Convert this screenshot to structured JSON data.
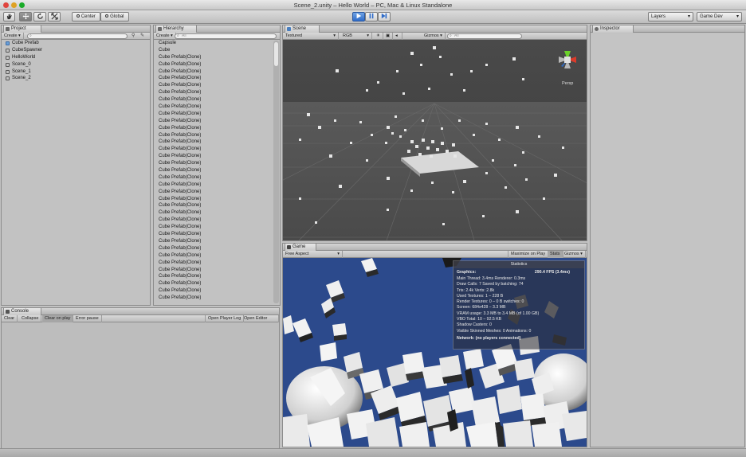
{
  "window": {
    "title": "Scene_2.unity – Hello World – PC, Mac & Linux Standalone"
  },
  "toolbar": {
    "pivot_label": "Center",
    "space_label": "Global",
    "layers_label": "Layers",
    "layout_label": "Game Dev"
  },
  "project": {
    "tab": "Project",
    "create_label": "Create",
    "items": [
      "Cube Prefab",
      "CubeSpawner",
      "HelloWorld",
      "Scene_0",
      "Scene_1",
      "Scene_2"
    ]
  },
  "hierarchy": {
    "tab": "Hierarchy",
    "create_label": "Create",
    "search_placeholder": "All",
    "items": [
      "Capsule",
      "Cube",
      "Cube Prefab(Clone)",
      "Cube Prefab(Clone)",
      "Cube Prefab(Clone)",
      "Cube Prefab(Clone)",
      "Cube Prefab(Clone)",
      "Cube Prefab(Clone)",
      "Cube Prefab(Clone)",
      "Cube Prefab(Clone)",
      "Cube Prefab(Clone)",
      "Cube Prefab(Clone)",
      "Cube Prefab(Clone)",
      "Cube Prefab(Clone)",
      "Cube Prefab(Clone)",
      "Cube Prefab(Clone)",
      "Cube Prefab(Clone)",
      "Cube Prefab(Clone)",
      "Cube Prefab(Clone)",
      "Cube Prefab(Clone)",
      "Cube Prefab(Clone)",
      "Cube Prefab(Clone)",
      "Cube Prefab(Clone)",
      "Cube Prefab(Clone)",
      "Cube Prefab(Clone)",
      "Cube Prefab(Clone)",
      "Cube Prefab(Clone)",
      "Cube Prefab(Clone)",
      "Cube Prefab(Clone)",
      "Cube Prefab(Clone)",
      "Cube Prefab(Clone)",
      "Cube Prefab(Clone)",
      "Cube Prefab(Clone)",
      "Cube Prefab(Clone)",
      "Cube Prefab(Clone)",
      "Cube Prefab(Clone)",
      "Cube Prefab(Clone)"
    ]
  },
  "scene": {
    "tab": "Scene",
    "shading": "Textured",
    "render_mode": "RGB",
    "gizmos_label": "Gizmos",
    "search_placeholder": "All",
    "persp_label": "Persp"
  },
  "game": {
    "tab": "Game",
    "aspect": "Free Aspect",
    "maximize_label": "Maximize on Play",
    "stats_label": "Stats",
    "gizmos_label": "Gizmos"
  },
  "statistics": {
    "title": "Statistics",
    "graphics_label": "Graphics:",
    "fps": "290.4 FPS (3.4ms)",
    "lines": [
      "Main Thread: 3.4ms  Renderer: 0.3ms",
      "Draw Calls: 7  Saved by batching: 74",
      "Tris: 2.4k  Verts: 2.8k",
      "Used Textures: 1 – 228 B",
      "Render Textures: 0 – 0 B  switches: 0",
      "Screen: 684x428 – 3.3 MB",
      "VRAM usage: 3.3 MB to 3.4 MB (of 1.00 GB)",
      "VBO Total: 10 – 92.5 KB",
      "Shadow Casters: 0",
      "Visible Skinned Meshes: 0  Animations: 0"
    ],
    "network": "Network: (no players connected)"
  },
  "console": {
    "tab": "Console",
    "buttons": [
      "Clear",
      "Collapse",
      "Clear on play",
      "Error pause"
    ],
    "right_buttons": [
      "Open Player Log",
      "Open Editor Log"
    ]
  },
  "inspector": {
    "tab": "Inspector"
  },
  "colors": {
    "game_sky": "#2c4a8c",
    "scene_bg": "#474747",
    "accent_blue": "#2f6cc9"
  }
}
